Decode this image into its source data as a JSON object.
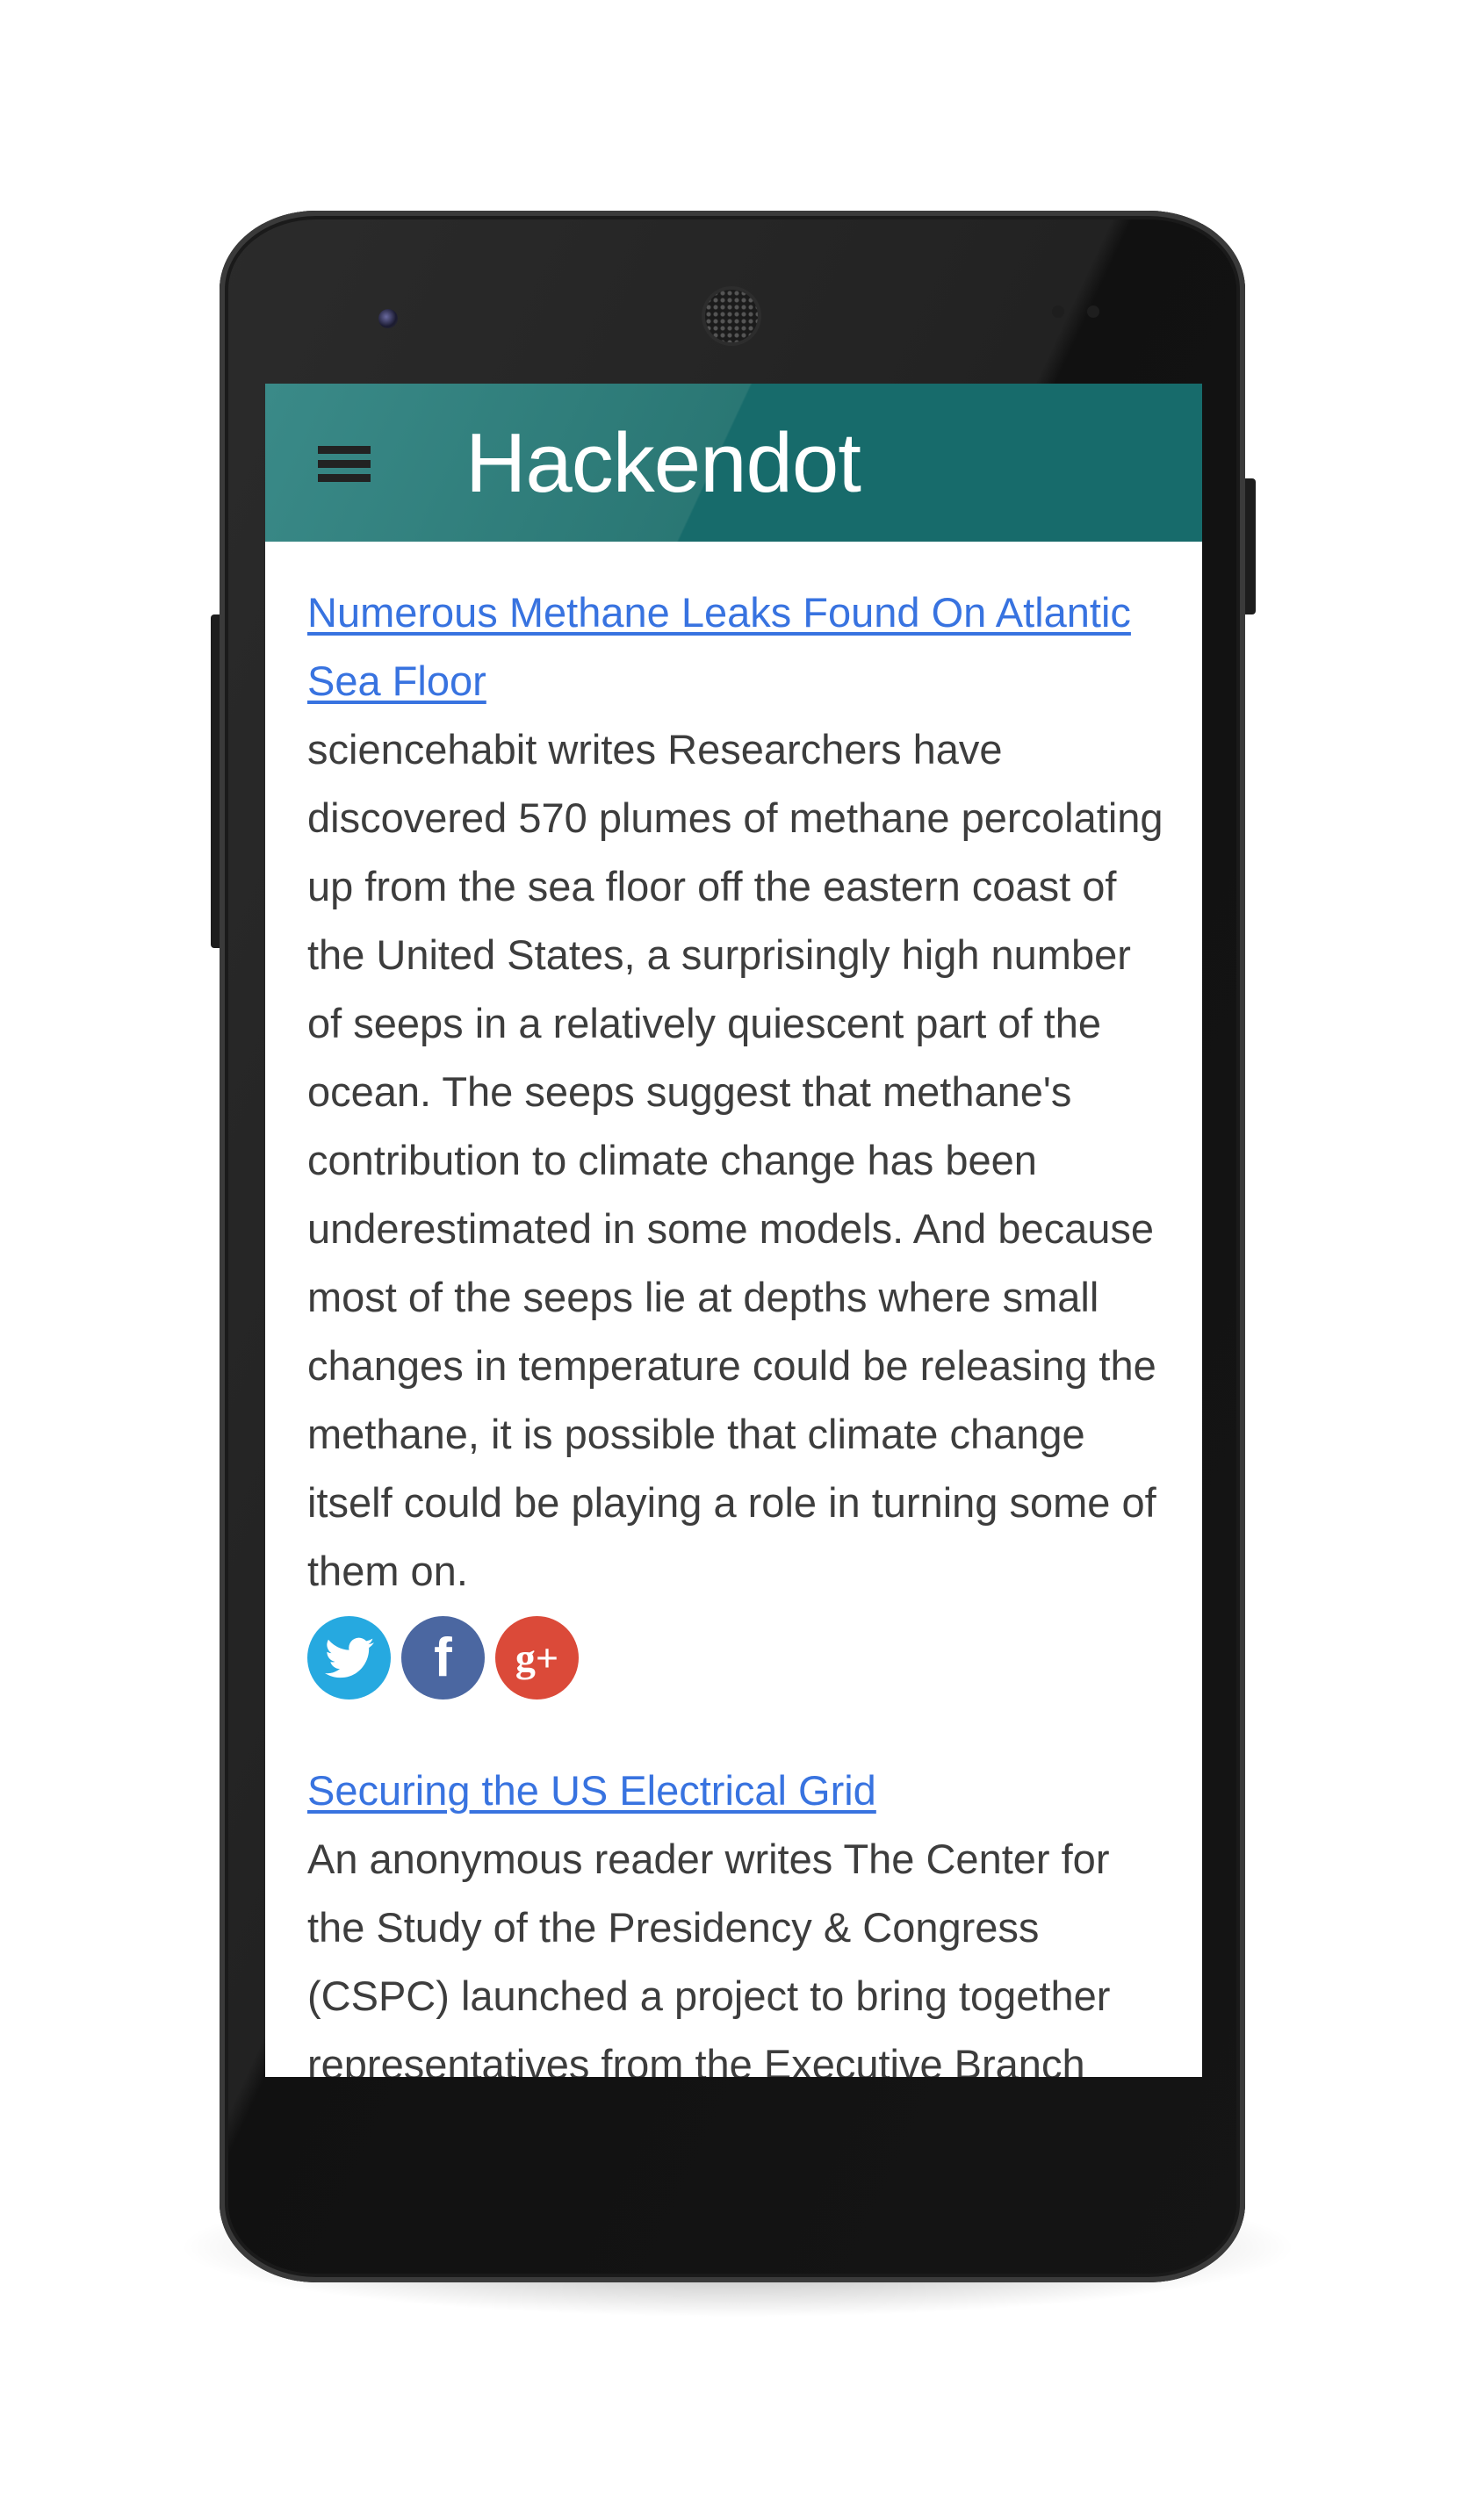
{
  "app": {
    "title": "Hackendot",
    "menu_icon": "hamburger-icon"
  },
  "colors": {
    "header": "#176b6b",
    "link": "#3873e0",
    "twitter": "#26a9e0",
    "facebook": "#4b67a1",
    "google_plus": "#db4a39"
  },
  "articles": [
    {
      "title": "Numerous Methane Leaks Found On Atlantic Sea Floor",
      "summary": "sciencehabit writes Researchers have discovered 570 plumes of methane percolating up from the sea floor off the eastern coast of the United States, a surprisingly high number of seeps in a relatively quiescent part of the ocean. The seeps suggest that methane's contribution to climate change has been underestimated in some models. And because most of the seeps lie at depths where small changes in temperature could be releasing the methane, it is possible that climate change itself could be playing a role in turning some of them on.",
      "share": [
        {
          "icon": "twitter-icon",
          "glyph": "🐦"
        },
        {
          "icon": "facebook-icon",
          "glyph": "f"
        },
        {
          "icon": "google-plus-icon",
          "glyph": "g+"
        }
      ]
    },
    {
      "title": "Securing the US Electrical Grid",
      "summary": "An anonymous reader writes The Center for the Study of the Presidency & Congress (CSPC) launched a project to bring together representatives from the Executive Branch"
    }
  ]
}
